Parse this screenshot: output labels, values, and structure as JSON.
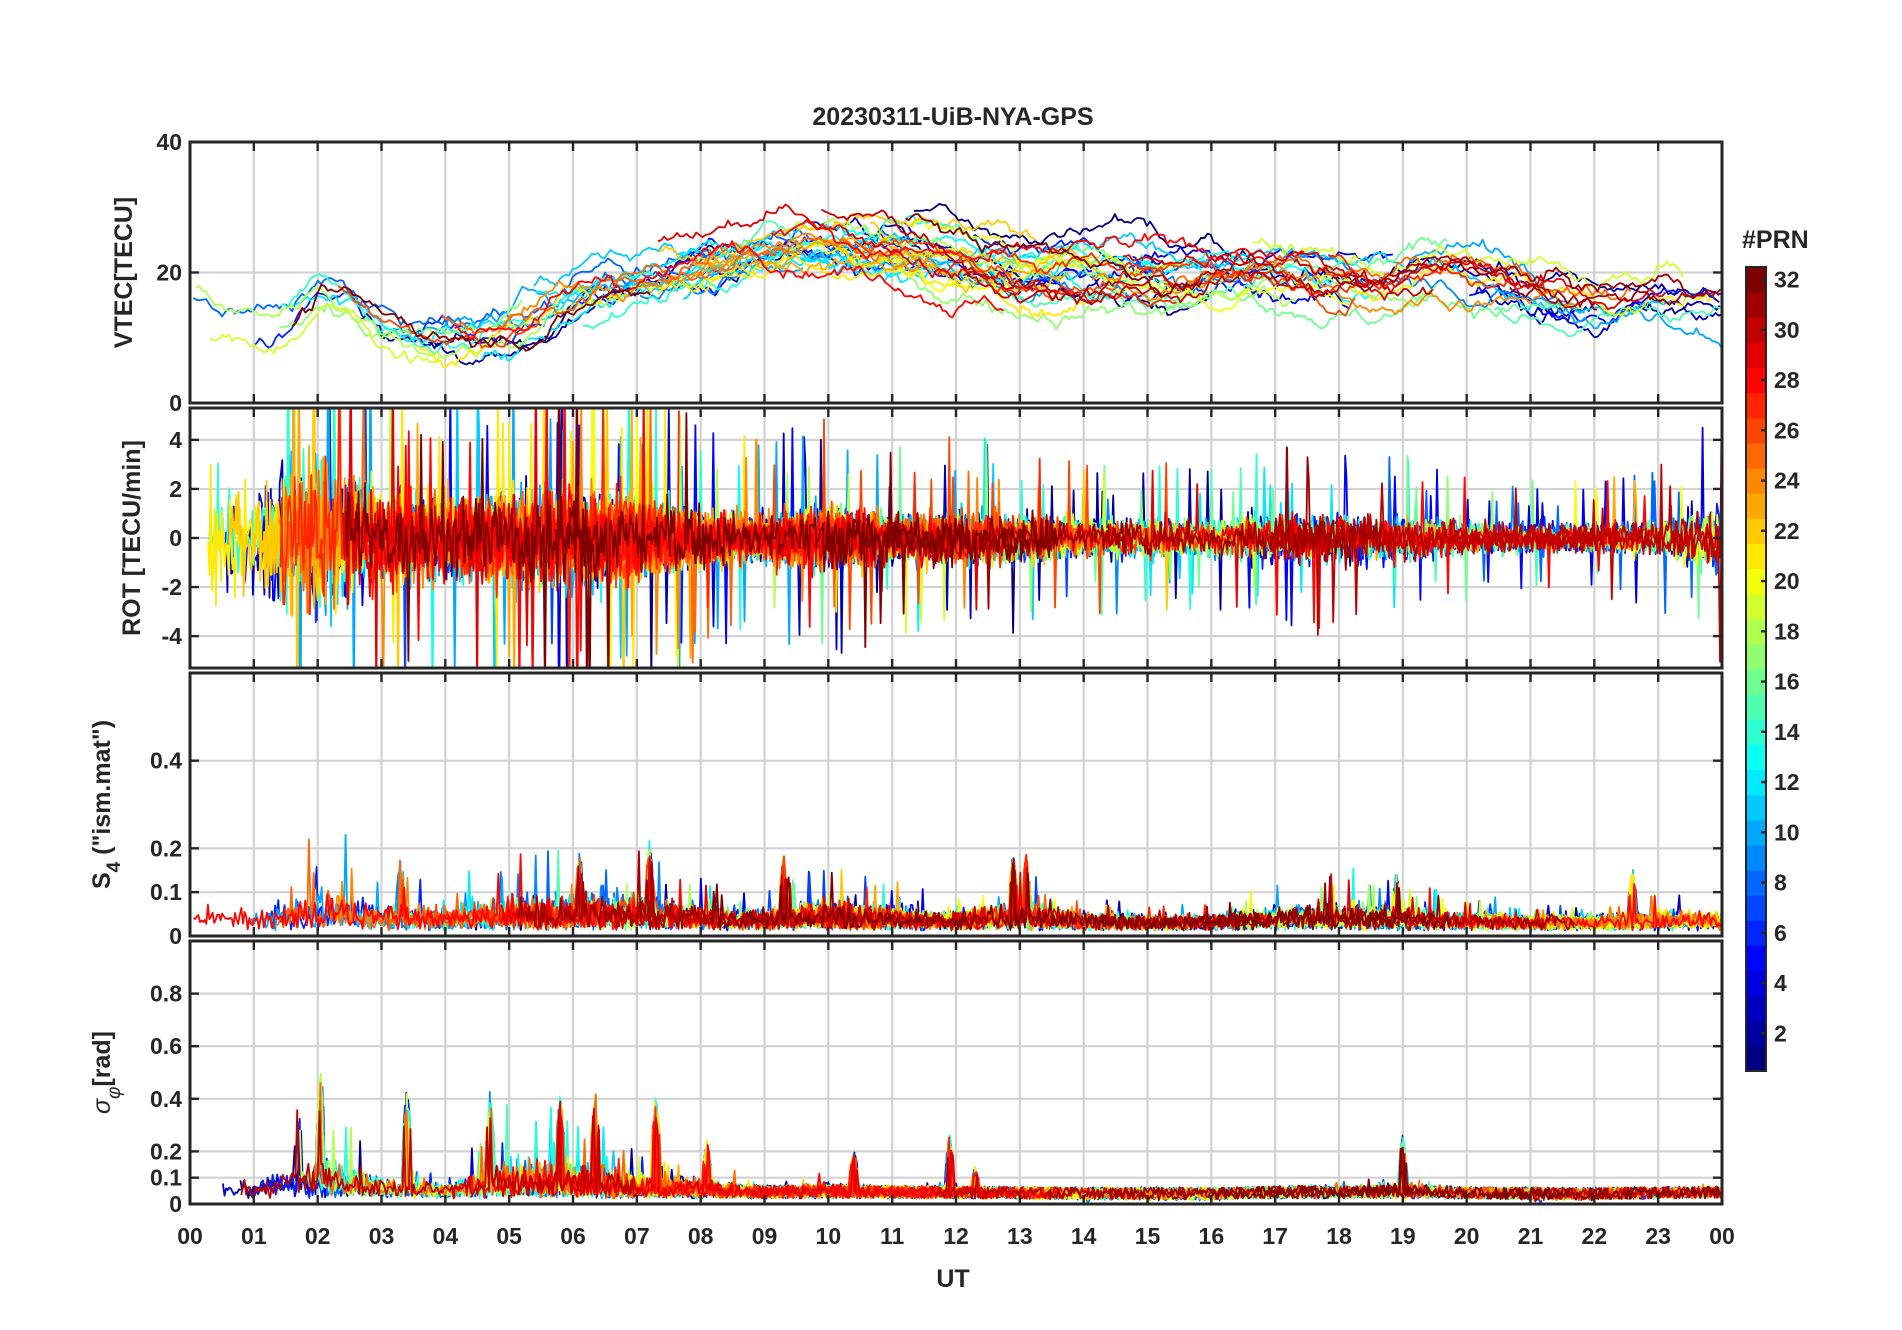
{
  "chart_data": {
    "type": "line",
    "title": "20230311-UiB-NYA-GPS",
    "xlabel": "UT",
    "x_ticks": [
      "00",
      "01",
      "02",
      "03",
      "04",
      "05",
      "06",
      "07",
      "08",
      "09",
      "10",
      "11",
      "12",
      "13",
      "14",
      "15",
      "16",
      "17",
      "18",
      "19",
      "20",
      "21",
      "22",
      "23",
      "00"
    ],
    "xlim_hours": [
      0,
      24
    ],
    "grid": true,
    "series_count": 32,
    "colorbar": {
      "label": "#PRN",
      "colormap": "jet",
      "range": [
        1,
        32
      ],
      "ticks": [
        "2",
        "4",
        "6",
        "8",
        "10",
        "12",
        "14",
        "16",
        "18",
        "20",
        "22",
        "24",
        "26",
        "28",
        "30",
        "32"
      ],
      "placement": "right"
    },
    "panels": [
      {
        "id": "vtec",
        "ylabel": "VTEC[TECU]",
        "ylim": [
          0,
          40
        ],
        "yticks": [
          0,
          20,
          40
        ],
        "ytick_labels": [
          "0",
          "20",
          "40"
        ],
        "profile": [
          [
            0,
            15
          ],
          [
            0.5,
            12
          ],
          [
            1,
            11
          ],
          [
            1.5,
            12
          ],
          [
            2,
            17
          ],
          [
            2.5,
            15
          ],
          [
            3,
            11
          ],
          [
            3.5,
            10
          ],
          [
            4,
            10
          ],
          [
            4.5,
            10
          ],
          [
            5,
            12
          ],
          [
            5.5,
            14
          ],
          [
            6,
            16
          ],
          [
            6.5,
            18
          ],
          [
            7,
            19
          ],
          [
            7.5,
            20
          ],
          [
            8,
            21
          ],
          [
            8.5,
            23
          ],
          [
            9,
            24
          ],
          [
            9.5,
            25
          ],
          [
            10,
            25
          ],
          [
            10.5,
            24
          ],
          [
            11,
            24
          ],
          [
            11.5,
            23
          ],
          [
            12,
            22
          ],
          [
            12.5,
            21
          ],
          [
            13,
            20
          ],
          [
            13.5,
            20
          ],
          [
            14,
            20
          ],
          [
            14.5,
            20
          ],
          [
            15,
            19
          ],
          [
            15.5,
            19
          ],
          [
            16,
            20
          ],
          [
            16.5,
            20
          ],
          [
            17,
            20
          ],
          [
            17.5,
            20
          ],
          [
            18,
            19
          ],
          [
            18.5,
            18
          ],
          [
            19,
            19
          ],
          [
            19.5,
            20
          ],
          [
            20,
            20
          ],
          [
            20.5,
            19
          ],
          [
            21,
            18
          ],
          [
            21.5,
            17
          ],
          [
            22,
            16
          ],
          [
            22.5,
            16
          ],
          [
            23,
            17
          ],
          [
            23.5,
            17
          ],
          [
            24,
            16
          ]
        ]
      },
      {
        "id": "rot",
        "ylabel": "ROT [TECU/min]",
        "ylim": [
          -5.3,
          5.3
        ],
        "yticks": [
          -4,
          -2,
          0,
          2,
          4
        ],
        "ytick_labels": [
          "-4",
          "-2",
          "0",
          "2",
          "4"
        ],
        "grid_values": [
          -4,
          -2,
          0,
          2,
          4
        ],
        "envelope": [
          [
            0,
            4
          ],
          [
            1,
            3.5
          ],
          [
            2,
            5
          ],
          [
            3,
            3
          ],
          [
            4,
            2.5
          ],
          [
            5,
            3
          ],
          [
            6,
            3
          ],
          [
            7,
            2.5
          ],
          [
            8,
            1.8
          ],
          [
            9,
            1.5
          ],
          [
            10,
            2
          ],
          [
            11,
            1.4
          ],
          [
            12,
            1.6
          ],
          [
            13,
            1.5
          ],
          [
            14,
            1.2
          ],
          [
            15,
            1.2
          ],
          [
            16,
            1.1
          ],
          [
            17,
            1.4
          ],
          [
            18,
            1.5
          ],
          [
            19,
            1.3
          ],
          [
            20,
            1.0
          ],
          [
            21,
            0.9
          ],
          [
            22,
            0.9
          ],
          [
            23,
            1.1
          ],
          [
            24,
            2
          ]
        ]
      },
      {
        "id": "s4",
        "ylabel_main": "S",
        "ylabel_sub": "4",
        "ylabel_rest": " (\"ism.mat\")",
        "ylim": [
          0,
          0.6
        ],
        "yticks": [
          0,
          0.1,
          0.2,
          0.4
        ],
        "ytick_labels": [
          "0",
          "0.1",
          "0.2",
          "0.4"
        ],
        "grid_values": [
          0.1,
          0.2,
          0.4
        ],
        "baseline": 0.03,
        "envelope": [
          [
            0,
            0.09
          ],
          [
            1,
            0.07
          ],
          [
            2,
            0.15
          ],
          [
            3,
            0.09
          ],
          [
            4,
            0.08
          ],
          [
            5,
            0.11
          ],
          [
            6,
            0.12
          ],
          [
            7,
            0.12
          ],
          [
            8,
            0.08
          ],
          [
            9,
            0.07
          ],
          [
            10,
            0.1
          ],
          [
            11,
            0.08
          ],
          [
            12,
            0.06
          ],
          [
            13,
            0.1
          ],
          [
            14,
            0.06
          ],
          [
            15,
            0.05
          ],
          [
            16,
            0.05
          ],
          [
            17,
            0.08
          ],
          [
            18,
            0.09
          ],
          [
            19,
            0.08
          ],
          [
            20,
            0.06
          ],
          [
            21,
            0.05
          ],
          [
            22,
            0.05
          ],
          [
            23,
            0.07
          ],
          [
            24,
            0.06
          ]
        ],
        "peaks": [
          [
            1.9,
            0.19
          ],
          [
            3.3,
            0.19
          ],
          [
            6.1,
            0.19
          ],
          [
            7.2,
            0.22
          ],
          [
            9.3,
            0.19
          ],
          [
            12.9,
            0.2
          ],
          [
            13.1,
            0.19
          ],
          [
            22.6,
            0.16
          ],
          [
            18.9,
            0.15
          ]
        ]
      },
      {
        "id": "sigma_phi",
        "ylabel_main": "σ",
        "ylabel_sub": "φ",
        "ylabel_rest": "[rad]",
        "ylim": [
          0,
          1.0
        ],
        "yticks": [
          0,
          0.1,
          0.2,
          0.4,
          0.6,
          0.8
        ],
        "ytick_labels": [
          "0",
          "0.1",
          "0.2",
          "0.4",
          "0.6",
          "0.8"
        ],
        "grid_values": [
          0.1,
          0.2,
          0.4,
          0.6,
          0.8
        ],
        "baseline": 0.05,
        "envelope": [
          [
            0,
            0.15
          ],
          [
            1,
            0.08
          ],
          [
            2,
            0.25
          ],
          [
            3,
            0.12
          ],
          [
            4,
            0.08
          ],
          [
            5,
            0.2
          ],
          [
            6,
            0.2
          ],
          [
            7,
            0.12
          ],
          [
            8,
            0.1
          ],
          [
            9,
            0.06
          ],
          [
            10,
            0.08
          ],
          [
            11,
            0.06
          ],
          [
            12,
            0.06
          ],
          [
            13,
            0.05
          ],
          [
            14,
            0.04
          ],
          [
            15,
            0.04
          ],
          [
            16,
            0.04
          ],
          [
            17,
            0.06
          ],
          [
            18,
            0.06
          ],
          [
            19,
            0.08
          ],
          [
            20,
            0.05
          ],
          [
            21,
            0.04
          ],
          [
            22,
            0.04
          ],
          [
            23,
            0.05
          ],
          [
            24,
            0.06
          ]
        ],
        "peaks": [
          [
            1.7,
            0.41
          ],
          [
            2.05,
            0.53
          ],
          [
            3.4,
            0.47
          ],
          [
            4.7,
            0.44
          ],
          [
            5.8,
            0.45
          ],
          [
            6.35,
            0.44
          ],
          [
            7.3,
            0.43
          ],
          [
            8.1,
            0.25
          ],
          [
            10.4,
            0.22
          ],
          [
            11.9,
            0.27
          ],
          [
            19.0,
            0.27
          ],
          [
            12.3,
            0.15
          ]
        ]
      }
    ]
  }
}
